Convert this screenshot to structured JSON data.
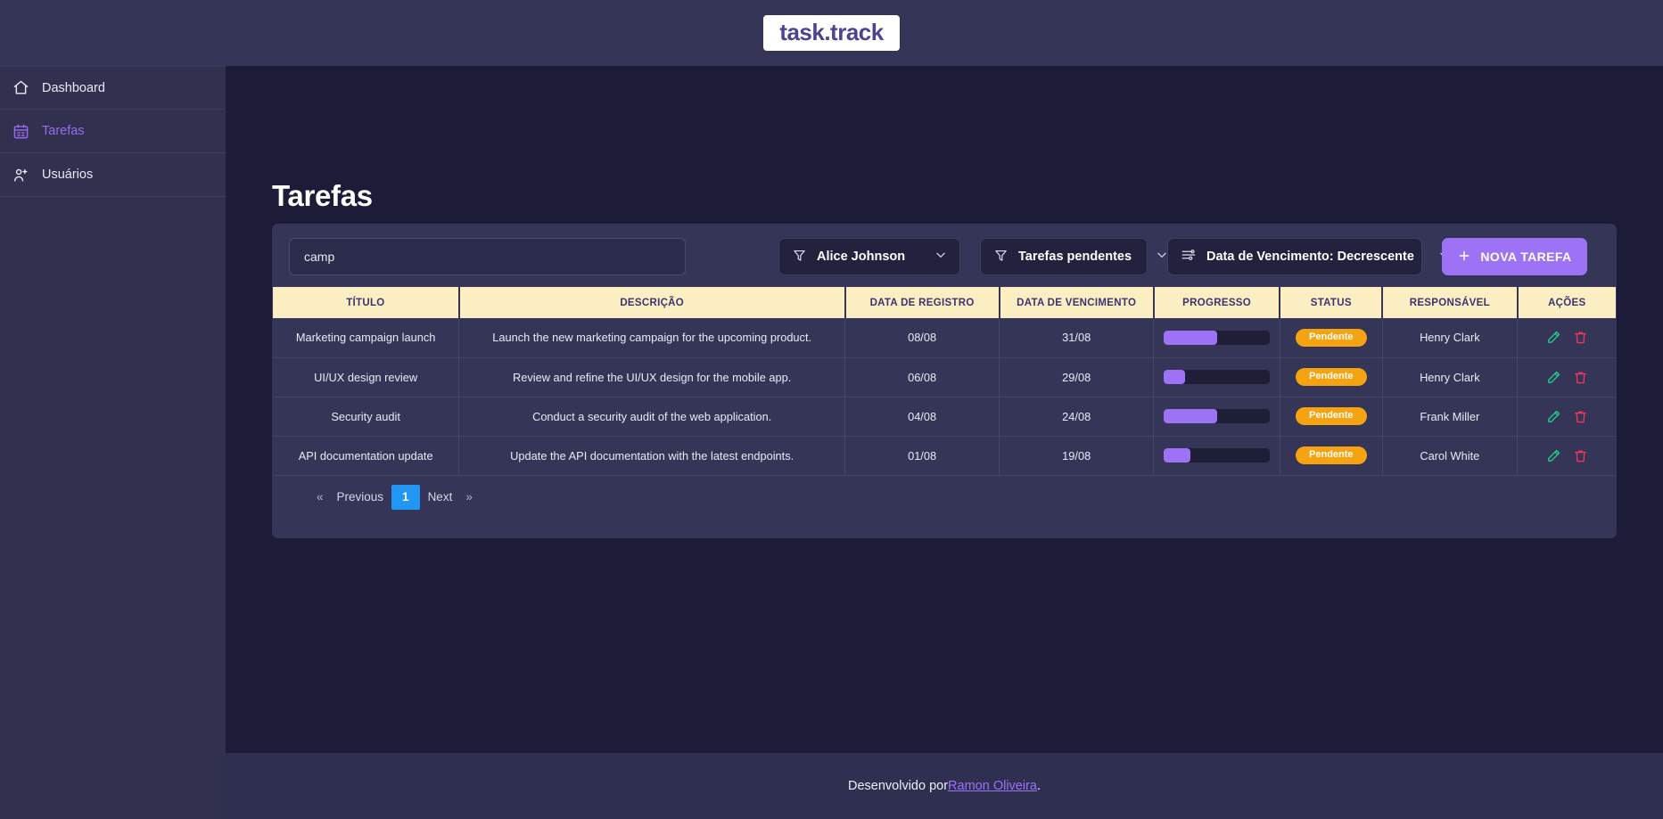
{
  "brand": {
    "logo_text": "task.track"
  },
  "sidebar": {
    "items": [
      {
        "label": "Dashboard",
        "icon": "home-icon",
        "active": false
      },
      {
        "label": "Tarefas",
        "icon": "calendar-icon",
        "active": true
      },
      {
        "label": "Usuários",
        "icon": "user-add-icon",
        "active": false
      }
    ]
  },
  "page": {
    "title": "Tarefas"
  },
  "toolbar": {
    "search": {
      "value": "camp",
      "placeholder": ""
    },
    "assignee_filter": {
      "label": "Alice Johnson",
      "icon": "filter-icon"
    },
    "status_filter": {
      "label": "Tarefas pendentes",
      "icon": "filter-icon"
    },
    "sort_filter": {
      "label": "Data de Vencimento: Decrescente",
      "icon": "sliders-icon"
    },
    "new_task_button": {
      "label": "NOVA TAREFA",
      "icon": "plus-icon",
      "color": "#9d72f5"
    }
  },
  "table": {
    "columns": [
      "TÍTULO",
      "DESCRIÇÃO",
      "DATA DE REGISTRO",
      "DATA DE VENCIMENTO",
      "PROGRESSO",
      "STATUS",
      "RESPONSÁVEL",
      "AÇÕES"
    ],
    "header_bg": "#fbeec3",
    "header_color": "#3c3470",
    "rows": [
      {
        "titulo": "Marketing campaign launch",
        "descricao": "Launch the new marketing campaign for the upcoming product.",
        "data_registro": "08/08",
        "data_vencimento": "31/08",
        "progresso": 50,
        "status": "Pendente",
        "responsavel": "Henry Clark"
      },
      {
        "titulo": "UI/UX design review",
        "descricao": "Review and refine the UI/UX design for the mobile app.",
        "data_registro": "06/08",
        "data_vencimento": "29/08",
        "progresso": 20,
        "status": "Pendente",
        "responsavel": "Henry Clark"
      },
      {
        "titulo": "Security audit",
        "descricao": "Conduct a security audit of the web application.",
        "data_registro": "04/08",
        "data_vencimento": "24/08",
        "progresso": 50,
        "status": "Pendente",
        "responsavel": "Frank Miller"
      },
      {
        "titulo": "API documentation update",
        "descricao": "Update the API documentation with the latest endpoints.",
        "data_registro": "01/08",
        "data_vencimento": "19/08",
        "progresso": 25,
        "status": "Pendente",
        "responsavel": "Carol White"
      }
    ],
    "status_badge_color": "#f5a310",
    "progress_color": "#9d72f5",
    "edit_icon_color": "#1fd18a",
    "delete_icon_color": "#f2355e"
  },
  "pagination": {
    "prev_chevron": "«",
    "prev_label": "Previous",
    "current_page": "1",
    "next_label": "Next",
    "next_chevron": "»",
    "current_color": "#2196f3"
  },
  "footer": {
    "prefix": "Desenvolvido por ",
    "author": "Ramon Oliveira",
    "suffix": "."
  }
}
